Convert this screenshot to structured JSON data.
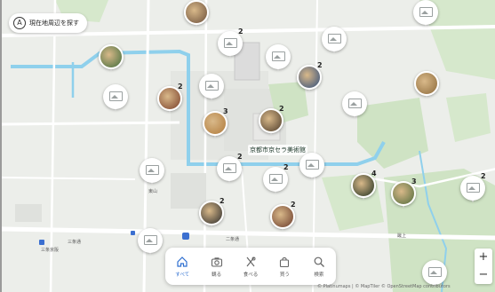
{
  "search_chip": {
    "icon": "A",
    "label": "現在地周辺を探す"
  },
  "place_label": "京都市京セラ美術館",
  "road_labels": [
    "三条通",
    "三条京阪",
    "東山",
    "蹴上",
    "二条通"
  ],
  "pins": [
    {
      "kind": "photo",
      "badge": "",
      "color": "#6b4f3a"
    },
    {
      "kind": "thumb",
      "badge": "2",
      "color": ""
    },
    {
      "kind": "thumb",
      "badge": "",
      "color": ""
    },
    {
      "kind": "thumb",
      "badge": "",
      "color": ""
    },
    {
      "kind": "photo",
      "badge": "",
      "color": "#3f6b3a"
    },
    {
      "kind": "thumb",
      "badge": "",
      "color": ""
    },
    {
      "kind": "thumb",
      "badge": "",
      "color": ""
    },
    {
      "kind": "photo",
      "badge": "2",
      "color": "#2f4c7a"
    },
    {
      "kind": "thumb",
      "badge": "",
      "color": ""
    },
    {
      "kind": "photo",
      "badge": "2",
      "color": "#7a3f2a"
    },
    {
      "kind": "thumb",
      "badge": "",
      "color": ""
    },
    {
      "kind": "photo",
      "badge": "",
      "color": "#8c6a3a"
    },
    {
      "kind": "photo",
      "badge": "3",
      "color": "#b07a3a"
    },
    {
      "kind": "photo",
      "badge": "2",
      "color": "#4c3b2a"
    },
    {
      "kind": "thumb",
      "badge": "",
      "color": ""
    },
    {
      "kind": "thumb",
      "badge": "2",
      "color": ""
    },
    {
      "kind": "thumb",
      "badge": "2",
      "color": ""
    },
    {
      "kind": "thumb",
      "badge": "",
      "color": ""
    },
    {
      "kind": "photo",
      "badge": "4",
      "color": "#1f2f1f"
    },
    {
      "kind": "photo",
      "badge": "3",
      "color": "#4f6a3a"
    },
    {
      "kind": "thumb",
      "badge": "2",
      "color": ""
    },
    {
      "kind": "photo",
      "badge": "2",
      "color": "#2a2a2a"
    },
    {
      "kind": "photo",
      "badge": "2",
      "color": "#6a3a2a"
    },
    {
      "kind": "thumb",
      "badge": "",
      "color": ""
    },
    {
      "kind": "thumb",
      "badge": "",
      "color": ""
    }
  ],
  "toolbar": [
    {
      "icon": "home-icon",
      "label": "すべて",
      "active": true
    },
    {
      "icon": "camera-icon",
      "label": "観る",
      "active": false
    },
    {
      "icon": "cutlery-icon",
      "label": "食べる",
      "active": false
    },
    {
      "icon": "shopping-bag-icon",
      "label": "買う",
      "active": false
    },
    {
      "icon": "search-icon",
      "label": "検索",
      "active": false
    }
  ],
  "zoom": {
    "in": "+",
    "out": "−"
  },
  "attribution": "© Platinumaps | © MapTiler © OpenStreetMap contributors",
  "colors": {
    "park": "#cfe3c4",
    "water": "#8fd0ec",
    "road": "#ffffff",
    "accent": "#2f6fd0"
  }
}
